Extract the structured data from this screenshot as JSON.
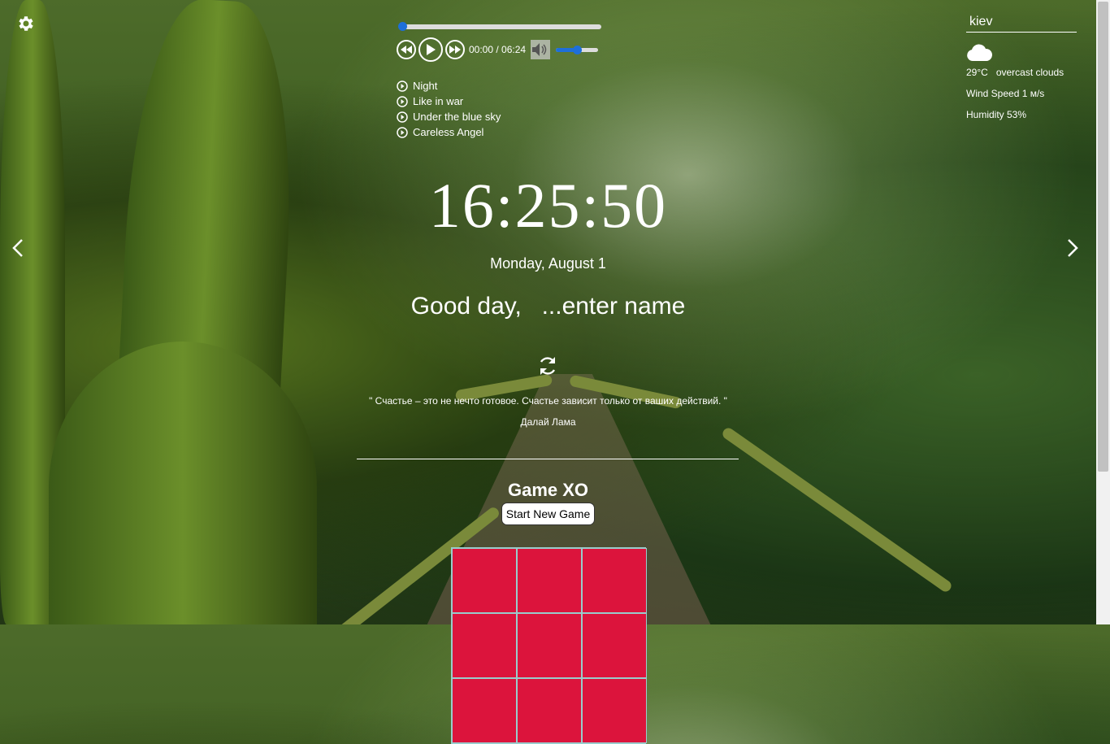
{
  "player": {
    "time": "00:00 / 06:24",
    "progress_fraction": 0,
    "volume_fraction": 0.5,
    "playlist": [
      {
        "title": "Night"
      },
      {
        "title": "Like in war"
      },
      {
        "title": "Under the blue sky"
      },
      {
        "title": "Careless Angel"
      }
    ]
  },
  "weather": {
    "city": "kiev",
    "icon": "cloud-icon",
    "temperature": "29°C",
    "description": "overcast clouds",
    "wind": "Wind Speed 1 м/s",
    "humidity": "Humidity 53%"
  },
  "clock": {
    "time": "16:25:50",
    "date": "Monday, August 1"
  },
  "greeting": {
    "text": "Good day,",
    "name_placeholder": "...enter name"
  },
  "quote": {
    "text": "\" Счастье – это не нечто готовое. Счастье зависит только от ваших действий. \"",
    "author": "Далай Лама"
  },
  "game": {
    "title": "Game XO",
    "start_label": "Start New Game",
    "cell_color": "#dc143c"
  },
  "icons": {
    "settings": "gear-icon",
    "prev_slide": "chevron-left-icon",
    "next_slide": "chevron-right-icon",
    "refresh_quote": "refresh-icon"
  }
}
